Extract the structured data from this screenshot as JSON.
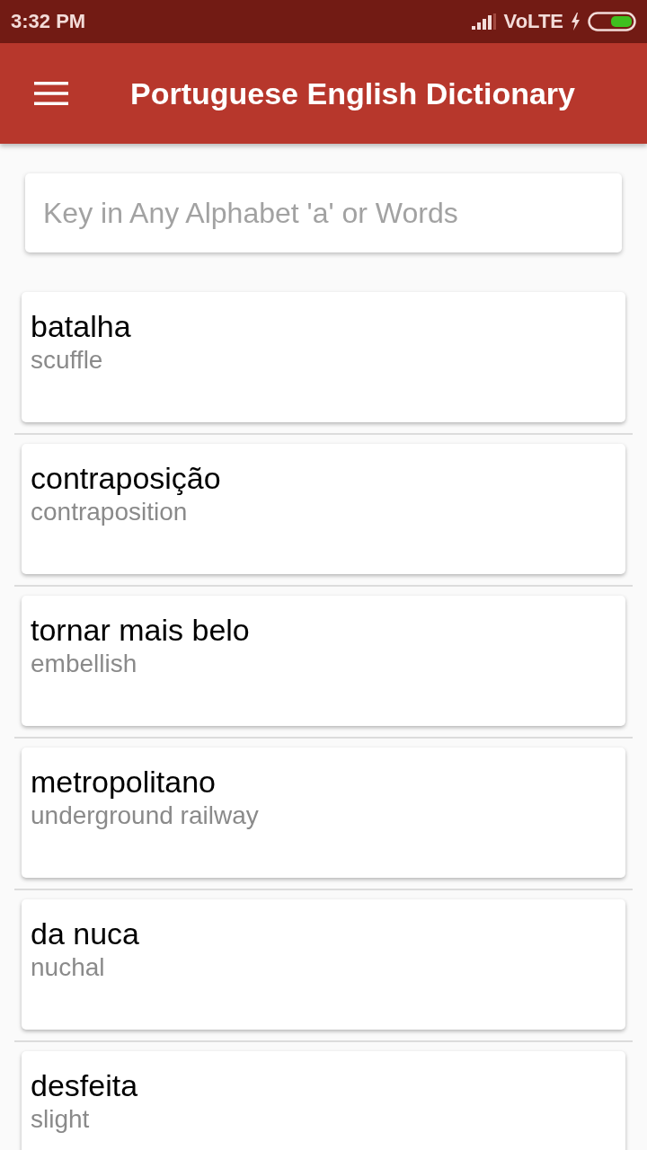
{
  "status_bar": {
    "time": "3:32 PM",
    "network": "VoLTE"
  },
  "app_bar": {
    "title": "Portuguese English Dictionary"
  },
  "search": {
    "placeholder": "Key in Any Alphabet 'a' or Words"
  },
  "entries": [
    {
      "word": "batalha",
      "meaning": "scuffle"
    },
    {
      "word": "contraposição",
      "meaning": "contraposition"
    },
    {
      "word": "tornar mais belo",
      "meaning": "embellish"
    },
    {
      "word": "metropolitano",
      "meaning": "underground railway"
    },
    {
      "word": "da nuca",
      "meaning": "nuchal"
    },
    {
      "word": "desfeita",
      "meaning": "slight"
    }
  ]
}
